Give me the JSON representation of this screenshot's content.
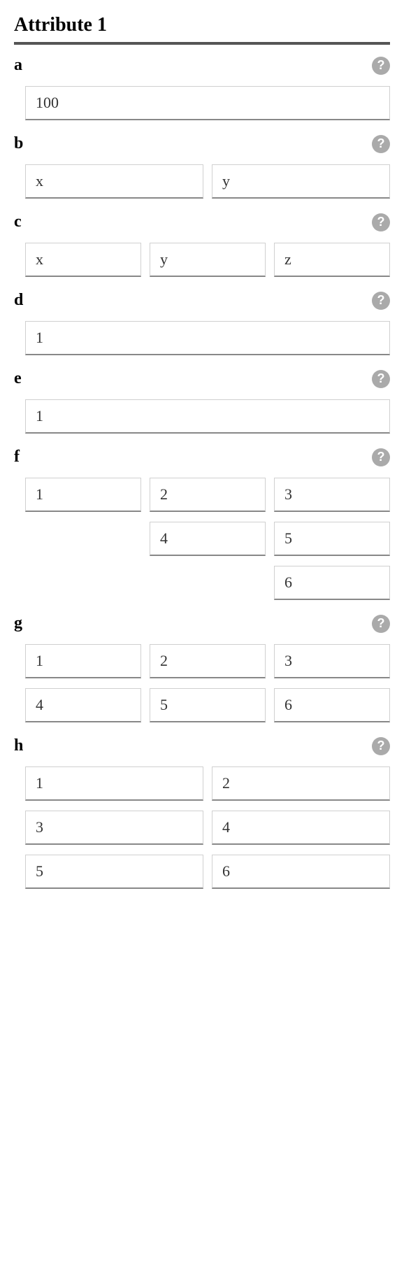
{
  "section": {
    "title": "Attribute 1",
    "fields": {
      "a": {
        "label": "a",
        "inputs": [
          "100"
        ]
      },
      "b": {
        "label": "b",
        "inputs": [
          "x",
          "y"
        ]
      },
      "c": {
        "label": "c",
        "inputs": [
          "x",
          "y",
          "z"
        ]
      },
      "d": {
        "label": "d",
        "inputs": [
          "1"
        ]
      },
      "e": {
        "label": "e",
        "inputs": [
          "1"
        ]
      },
      "f": {
        "label": "f",
        "rows": [
          [
            "1",
            "2",
            "3"
          ],
          [
            "",
            "4",
            "5"
          ],
          [
            "",
            "",
            "6"
          ]
        ]
      },
      "g": {
        "label": "g",
        "rows": [
          [
            "1",
            "2",
            "3"
          ],
          [
            "4",
            "5",
            "6"
          ]
        ]
      },
      "h": {
        "label": "h",
        "rows": [
          [
            "1",
            "2"
          ],
          [
            "3",
            "4"
          ],
          [
            "5",
            "6"
          ]
        ]
      }
    }
  },
  "help_symbol": "?"
}
